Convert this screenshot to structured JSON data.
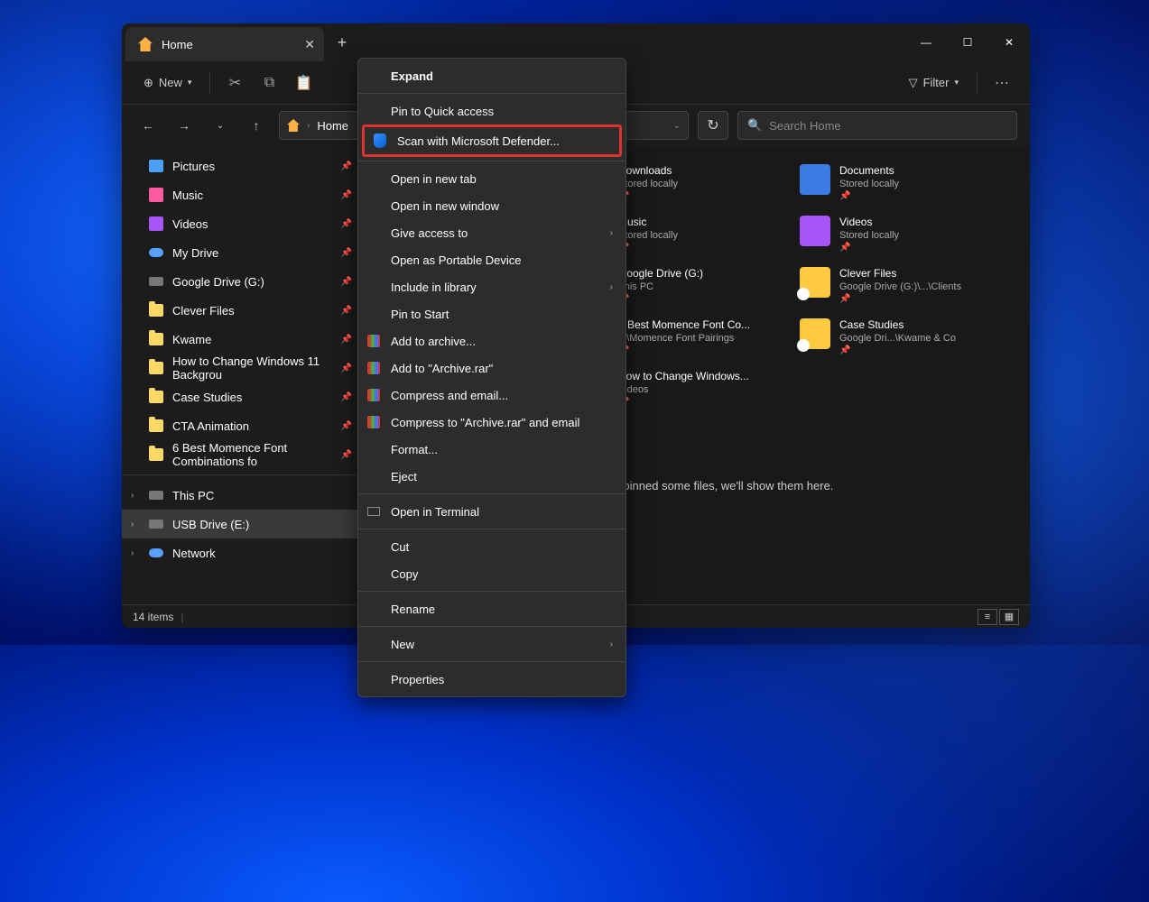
{
  "tab": {
    "title": "Home"
  },
  "toolbar": {
    "new": "New",
    "filter": "Filter"
  },
  "address": {
    "location": "Home"
  },
  "search": {
    "placeholder": "Search Home"
  },
  "sidebar": {
    "quickaccess": [
      {
        "label": "Pictures",
        "icon": "folder-blue"
      },
      {
        "label": "Music",
        "icon": "ic-pink"
      },
      {
        "label": "Videos",
        "icon": "ic-purple"
      },
      {
        "label": "My Drive",
        "icon": "ic-cloud"
      },
      {
        "label": "Google Drive (G:)",
        "icon": "ic-drive"
      },
      {
        "label": "Clever Files",
        "icon": "folder-yellow"
      },
      {
        "label": "Kwame",
        "icon": "folder-yellow"
      },
      {
        "label": "How to Change Windows 11 Backgrou",
        "icon": "folder-yellow"
      },
      {
        "label": "Case Studies",
        "icon": "folder-yellow"
      },
      {
        "label": "CTA Animation",
        "icon": "folder-yellow"
      },
      {
        "label": "6 Best Momence Font Combinations fo",
        "icon": "folder-yellow"
      }
    ],
    "nav": [
      {
        "label": "This PC",
        "icon": "ic-drive"
      },
      {
        "label": "USB Drive (E:)",
        "icon": "ic-drive",
        "selected": true
      },
      {
        "label": "Network",
        "icon": "ic-cloud"
      }
    ]
  },
  "tiles": [
    {
      "title": "Downloads",
      "sub": "Stored locally",
      "cls": "dl"
    },
    {
      "title": "Documents",
      "sub": "Stored locally",
      "cls": "docs"
    },
    {
      "title": "Music",
      "sub": "Stored locally",
      "cls": "mus"
    },
    {
      "title": "Videos",
      "sub": "Stored locally",
      "cls": "vid"
    },
    {
      "title": "Google Drive (G:)",
      "sub": "This PC",
      "cls": "drv"
    },
    {
      "title": "Clever Files",
      "sub": "Google Drive (G:)\\...\\Clients",
      "cls": "cloud"
    },
    {
      "title": "6 Best Momence Font Co...",
      "sub": "...\\Momence Font Pairings",
      "cls": "fld"
    },
    {
      "title": "Case Studies",
      "sub": "Google Dri...\\Kwame & Co",
      "cls": "cloud"
    },
    {
      "title": "How to Change Windows...",
      "sub": "Videos",
      "cls": "fld"
    }
  ],
  "footer_msg": "After you've pinned some files, we'll show them here.",
  "status": {
    "count": "14 items"
  },
  "context_menu": {
    "items": [
      {
        "label": "Expand",
        "bold": true
      },
      {
        "sep": true
      },
      {
        "label": "Pin to Quick access"
      },
      {
        "label": "Scan with Microsoft Defender...",
        "icon": "shield",
        "highlight": true
      },
      {
        "sep": true
      },
      {
        "label": "Open in new tab"
      },
      {
        "label": "Open in new window"
      },
      {
        "label": "Give access to",
        "submenu": true
      },
      {
        "label": "Open as Portable Device"
      },
      {
        "label": "Include in library",
        "submenu": true
      },
      {
        "label": "Pin to Start"
      },
      {
        "label": "Add to archive...",
        "icon": "archive"
      },
      {
        "label": "Add to \"Archive.rar\"",
        "icon": "archive"
      },
      {
        "label": "Compress and email...",
        "icon": "archive"
      },
      {
        "label": "Compress to \"Archive.rar\" and email",
        "icon": "archive"
      },
      {
        "label": "Format..."
      },
      {
        "label": "Eject"
      },
      {
        "sep": true
      },
      {
        "label": "Open in Terminal",
        "icon": "term"
      },
      {
        "sep": true
      },
      {
        "label": "Cut"
      },
      {
        "label": "Copy"
      },
      {
        "sep": true
      },
      {
        "label": "Rename"
      },
      {
        "sep": true
      },
      {
        "label": "New",
        "submenu": true
      },
      {
        "sep": true
      },
      {
        "label": "Properties"
      }
    ]
  }
}
